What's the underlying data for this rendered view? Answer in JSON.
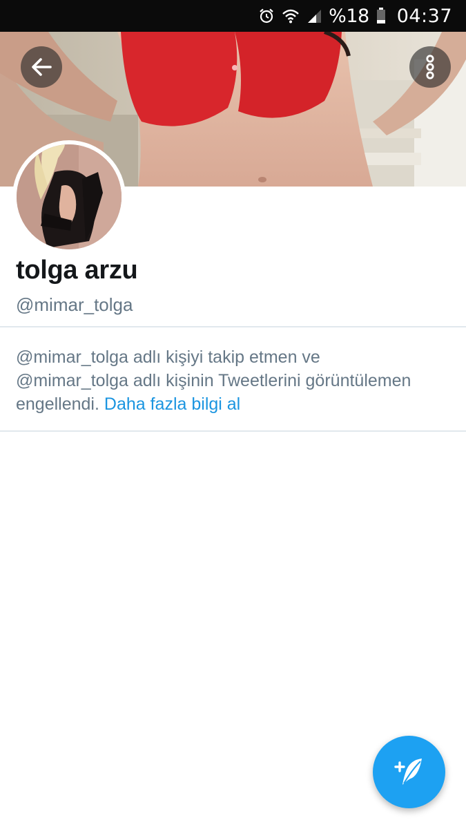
{
  "status_bar": {
    "battery_percent": "%18",
    "time": "04:37",
    "icons": [
      "alarm-icon",
      "wifi-icon",
      "cell-signal-icon",
      "battery-icon"
    ]
  },
  "header": {
    "back_icon": "arrow-left-icon",
    "more_icon": "more-vertical-icon"
  },
  "profile": {
    "display_name": "tolga arzu",
    "handle": "@mimar_tolga"
  },
  "blocked_notice": {
    "line1": "@mimar_tolga adlı kişiyi takip etmen ve",
    "line2": "@mimar_tolga adlı kişinin Tweetlerini görüntülemen",
    "line3_prefix": "engellendi. ",
    "learn_more": "Daha fazla bilgi al"
  },
  "fab": {
    "icon": "compose-tweet-icon"
  },
  "colors": {
    "accent": "#1da1f2",
    "link": "#1b95e0",
    "secondary_text": "#657786",
    "divider": "#e1e8ed",
    "status_bar": "#0b0b0b"
  }
}
